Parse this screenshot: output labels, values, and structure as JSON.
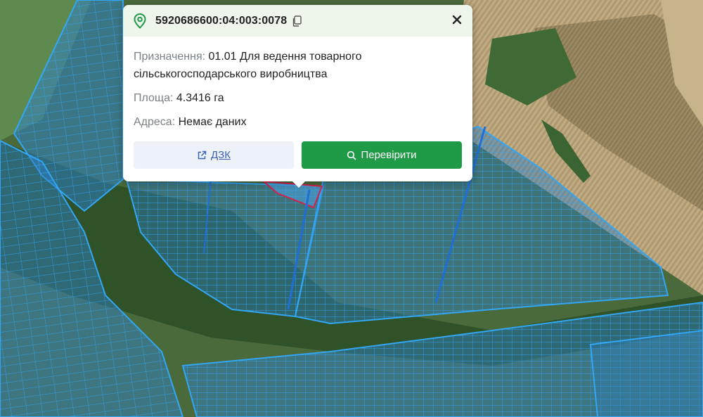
{
  "map": {
    "colors": {
      "parcel_fill": "#2f7fc4",
      "parcel_stroke": "#33a6f4",
      "selected_stroke": "#d8204a",
      "field_light": "#b7a178",
      "field_dark": "#8a7a55",
      "vegetation": "#3f6a36"
    }
  },
  "popup": {
    "cadastral_number": "5920686600:04:003:0078",
    "icons": {
      "location": "map-pin-icon",
      "copy": "copy-icon",
      "close": "close-icon",
      "external_link": "external-link-icon",
      "search": "search-icon"
    },
    "purpose": {
      "label": "Призначення:",
      "value": "01.01 Для ведення товарного сільськогосподарського виробництва"
    },
    "area": {
      "label": "Площа:",
      "value": "4.3416 га"
    },
    "address": {
      "label": "Адреса:",
      "value": "Немає даних"
    },
    "buttons": {
      "dzk": "ДЗК",
      "check": "Перевірити"
    },
    "colors": {
      "header_bg": "#eef6ec",
      "accent_green": "#1f9a46",
      "link_blue": "#3d63b0"
    }
  }
}
